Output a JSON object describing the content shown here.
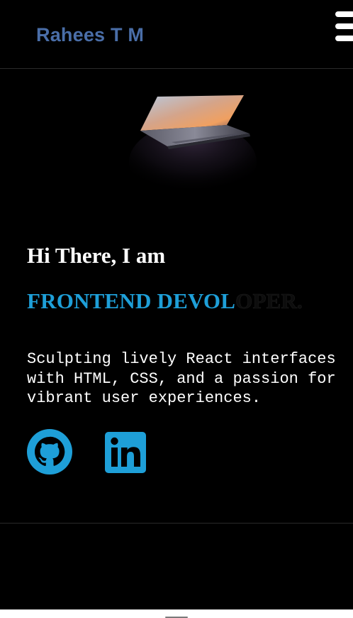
{
  "header": {
    "brand_name": "Rahees T M",
    "menu_icon": "hamburger-menu-icon"
  },
  "hero": {
    "image_subject": "laptop",
    "greeting": "Hi There, I am",
    "role_typed": "FRONTEND DEVOL",
    "role_ghost": "OPER.",
    "tagline": "Sculpting lively React interfaces with HTML, CSS, and a passion for vibrant user experiences."
  },
  "socials": [
    {
      "name": "GitHub",
      "icon": "github-icon"
    },
    {
      "name": "LinkedIn",
      "icon": "linkedin-icon"
    }
  ],
  "colors": {
    "background": "#000000",
    "brand": "#4a6ea8",
    "accent": "#1e9fd8",
    "text": "#ffffff"
  }
}
